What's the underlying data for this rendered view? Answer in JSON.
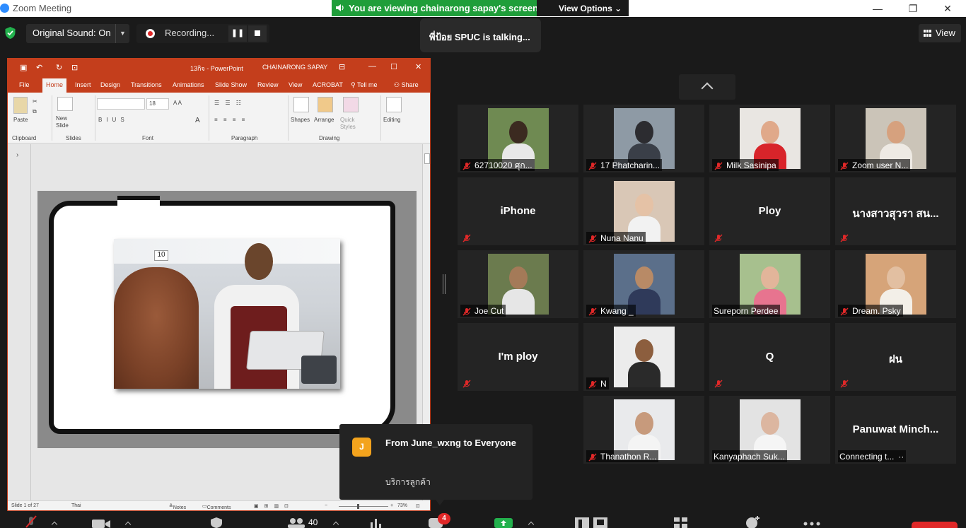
{
  "window": {
    "title": "Zoom Meeting",
    "minimize": "—",
    "maximize": "❐",
    "close": "✕"
  },
  "banner": {
    "message": "You are viewing chainarong sapay's screen",
    "view_options": "View Options ⌄",
    "color": "#1f9e3a"
  },
  "controls": {
    "original_sound": "Original Sound: On",
    "recording": "Recording...",
    "talking": "พี่ป้อย SPUC is talking...",
    "view": "View"
  },
  "powerpoint": {
    "file_name": "13กิจ",
    "app_name": "PowerPoint",
    "user": "CHAINARONG SAPAY",
    "tabs": [
      "File",
      "Home",
      "Insert",
      "Design",
      "Transitions",
      "Animations",
      "Slide Show",
      "Review",
      "View",
      "ACROBAT",
      "Tell me",
      "Share"
    ],
    "groups": {
      "clipboard": "Clipboard",
      "slides": "Slides",
      "font": "Font",
      "paragraph": "Paragraph",
      "drawing": "Drawing"
    },
    "buttons": {
      "paste": "Paste",
      "new_slide": "New Slide",
      "shapes": "Shapes",
      "arrange": "Arrange",
      "quick_styles": "Quick Styles",
      "editing": "Editing"
    },
    "font_size": "18",
    "slide_number": "10",
    "status": {
      "slide": "Slide 1 of 27",
      "language": "Thai",
      "notes": "Notes",
      "comments": "Comments",
      "zoom": "73%"
    },
    "accent": "#c43e1c"
  },
  "participants": [
    {
      "name": "62710020 ศุก...",
      "video": true,
      "muted": true,
      "colors": [
        "#6f8a52",
        "#3b2a20",
        "#e8e8e8"
      ]
    },
    {
      "name": "17 Phatcharin...",
      "video": true,
      "muted": true,
      "colors": [
        "#8e9aa5",
        "#2c2c30",
        "#3a3f48"
      ]
    },
    {
      "name": "Milk Sasinipa",
      "video": true,
      "muted": true,
      "colors": [
        "#e9e6e2",
        "#e0a98a",
        "#d8242a"
      ]
    },
    {
      "name": "Zoom user N...",
      "video": true,
      "muted": true,
      "colors": [
        "#cbc4b8",
        "#d6a17e",
        "#eeeae4"
      ]
    },
    {
      "name": "iPhone",
      "video": false,
      "muted": true
    },
    {
      "name": "Nuna Nanu",
      "video": true,
      "muted": true,
      "colors": [
        "#d9c7b6",
        "#e5c2a6",
        "#f2f2f2"
      ]
    },
    {
      "name": "Ploy",
      "video": false,
      "muted": true
    },
    {
      "name": "นางสาวสุวรา สน...",
      "video": false,
      "muted": true
    },
    {
      "name": "Joe Cut",
      "video": true,
      "muted": true,
      "colors": [
        "#6b7b4e",
        "#a47a58",
        "#e6e6e6"
      ]
    },
    {
      "name": "Kwang _",
      "video": true,
      "muted": true,
      "colors": [
        "#5b6f8a",
        "#b88a66",
        "#2f3a5a"
      ]
    },
    {
      "name": "Sureporn Perdee",
      "video": true,
      "muted": false,
      "colors": [
        "#a7c08e",
        "#e2b59a",
        "#e7748f"
      ]
    },
    {
      "name": "Dream. Psky",
      "video": true,
      "muted": true,
      "colors": [
        "#d6a479",
        "#e2bfa1",
        "#f3efe8"
      ]
    },
    {
      "name": "I'm ploy",
      "video": false,
      "muted": true
    },
    {
      "name": "N",
      "video": true,
      "muted": true,
      "colors": [
        "#ececec",
        "#8c5e3e",
        "#2a2a2a"
      ]
    },
    {
      "name": "Q",
      "video": false,
      "muted": true
    },
    {
      "name": "ฝน",
      "video": false,
      "muted": true
    },
    {
      "name": "Thanathon R...",
      "video": true,
      "muted": true,
      "colors": [
        "#e9eaec",
        "#c79a7c",
        "#f4f4f4"
      ]
    },
    {
      "name": "Kanyaphach Suk...",
      "video": true,
      "muted": false,
      "colors": [
        "#e3e3e3",
        "#dcb6a0",
        "#f5f5f5"
      ]
    },
    {
      "name": "Panuwat Minch...",
      "video": false,
      "muted": false,
      "status": "Connecting t..."
    }
  ],
  "chat_toast": {
    "avatar": "J",
    "header": "From June_wxng to Everyone",
    "message": "บริการลูกค้า"
  },
  "toolbar": {
    "participant_count": "40",
    "chat_badge": "4"
  },
  "icons": {
    "security": "shield-check-icon",
    "speaker": "speaker-icon",
    "mute": "mic-muted-icon"
  }
}
